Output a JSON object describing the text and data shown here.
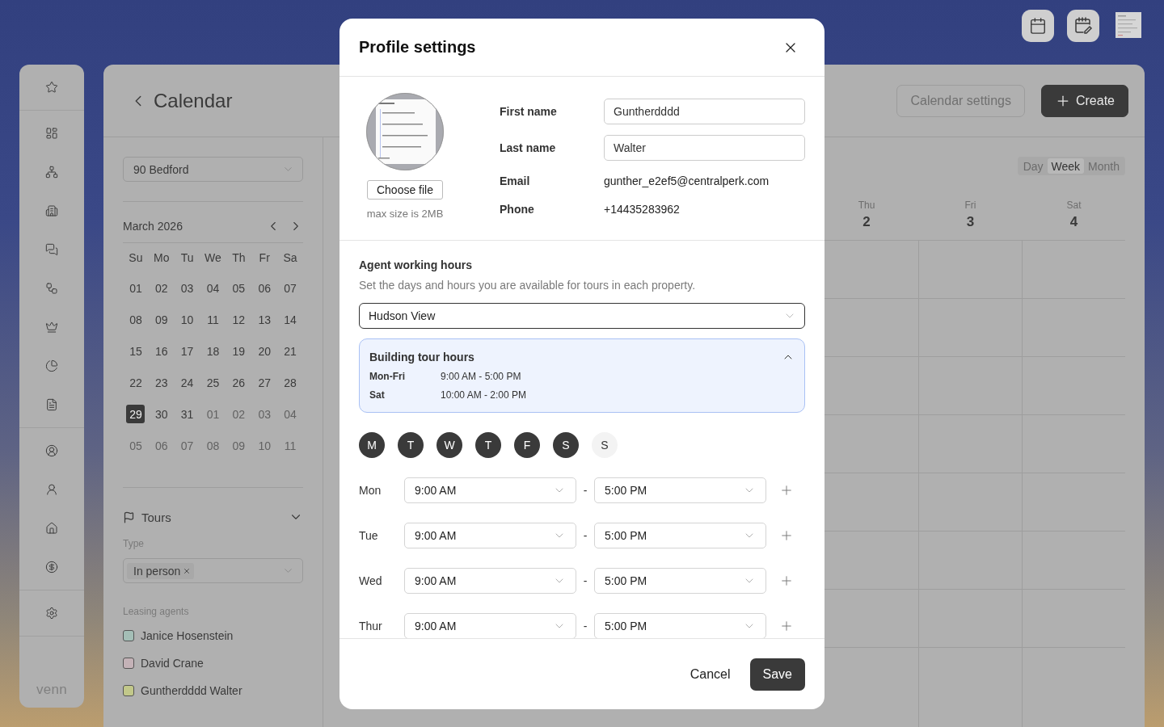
{
  "calendar_page": {
    "title": "Calendar",
    "actions": [
      {
        "label": "Calendar settings",
        "kind": "outline"
      },
      {
        "label": "Create",
        "kind": "primary"
      }
    ],
    "views": [
      {
        "label": "Day",
        "selected": false
      },
      {
        "label": "Week",
        "selected": true
      },
      {
        "label": "Month",
        "selected": false
      }
    ],
    "week_columns": [
      {
        "weekday": "Thu",
        "date": "2"
      },
      {
        "weekday": "Fri",
        "date": "3"
      },
      {
        "weekday": "Sat",
        "date": "4"
      }
    ]
  },
  "sidebar": {
    "brand": "venn"
  },
  "filters": {
    "property": "90 Bedford",
    "month": "March 2026",
    "weekdays": [
      "Su",
      "Mo",
      "Tu",
      "We",
      "Th",
      "Fr",
      "Sa"
    ],
    "days": [
      {
        "label": "01",
        "muted": false,
        "selected": false
      },
      {
        "label": "02",
        "muted": false,
        "selected": false
      },
      {
        "label": "03",
        "muted": false,
        "selected": false
      },
      {
        "label": "04",
        "muted": false,
        "selected": false
      },
      {
        "label": "05",
        "muted": false,
        "selected": false
      },
      {
        "label": "06",
        "muted": false,
        "selected": false
      },
      {
        "label": "07",
        "muted": false,
        "selected": false
      },
      {
        "label": "08",
        "muted": false,
        "selected": false
      },
      {
        "label": "09",
        "muted": false,
        "selected": false
      },
      {
        "label": "10",
        "muted": false,
        "selected": false
      },
      {
        "label": "11",
        "muted": false,
        "selected": false
      },
      {
        "label": "12",
        "muted": false,
        "selected": false
      },
      {
        "label": "13",
        "muted": false,
        "selected": false
      },
      {
        "label": "14",
        "muted": false,
        "selected": false
      },
      {
        "label": "15",
        "muted": false,
        "selected": false
      },
      {
        "label": "16",
        "muted": false,
        "selected": false
      },
      {
        "label": "17",
        "muted": false,
        "selected": false
      },
      {
        "label": "18",
        "muted": false,
        "selected": false
      },
      {
        "label": "19",
        "muted": false,
        "selected": false
      },
      {
        "label": "20",
        "muted": false,
        "selected": false
      },
      {
        "label": "21",
        "muted": false,
        "selected": false
      },
      {
        "label": "22",
        "muted": false,
        "selected": false
      },
      {
        "label": "23",
        "muted": false,
        "selected": false
      },
      {
        "label": "24",
        "muted": false,
        "selected": false
      },
      {
        "label": "25",
        "muted": false,
        "selected": false
      },
      {
        "label": "26",
        "muted": false,
        "selected": false
      },
      {
        "label": "27",
        "muted": false,
        "selected": false
      },
      {
        "label": "28",
        "muted": false,
        "selected": false
      },
      {
        "label": "29",
        "muted": false,
        "selected": true
      },
      {
        "label": "30",
        "muted": false,
        "selected": false
      },
      {
        "label": "31",
        "muted": false,
        "selected": false
      },
      {
        "label": "01",
        "muted": true,
        "selected": false
      },
      {
        "label": "02",
        "muted": true,
        "selected": false
      },
      {
        "label": "03",
        "muted": true,
        "selected": false
      },
      {
        "label": "04",
        "muted": true,
        "selected": false
      },
      {
        "label": "05",
        "muted": true,
        "selected": false
      },
      {
        "label": "06",
        "muted": true,
        "selected": false
      },
      {
        "label": "07",
        "muted": true,
        "selected": false
      },
      {
        "label": "08",
        "muted": true,
        "selected": false
      },
      {
        "label": "09",
        "muted": true,
        "selected": false
      },
      {
        "label": "10",
        "muted": true,
        "selected": false
      },
      {
        "label": "11",
        "muted": true,
        "selected": false
      }
    ],
    "tours": {
      "title": "Tours",
      "expanded": true,
      "type_label": "Type",
      "type_chips": [
        "In person"
      ],
      "agents_label": "Leasing agents",
      "agents": [
        {
          "name": "Janice Hosenstein",
          "color": "#a4beb6",
          "checked": false
        },
        {
          "name": "David Crane",
          "color": "#c4b2b7",
          "checked": false
        },
        {
          "name": "Guntherdddd Walter",
          "color": "#c2c88a",
          "checked": false
        }
      ]
    }
  },
  "modal": {
    "title": "Profile settings",
    "upload_button": "Choose file",
    "upload_hint": "max size is 2MB",
    "fields": [
      {
        "label": "First name",
        "value": "Guntherdddd",
        "kind": "input"
      },
      {
        "label": "Last name",
        "value": "Walter",
        "kind": "input"
      },
      {
        "label": "Email",
        "value": "gunther_e2ef5@centralperk.com",
        "kind": "text"
      },
      {
        "label": "Phone",
        "value": "+14435283962",
        "kind": "text"
      }
    ],
    "hours_title": "Agent working hours",
    "hours_description": "Set the days and hours you are available for tours in each property.",
    "property": "Hudson View",
    "building_hours": {
      "title": "Building tour hours",
      "expanded": true,
      "rows": [
        {
          "days": "Mon-Fri",
          "hours": "9:00 AM - 5:00 PM"
        },
        {
          "days": "Sat",
          "hours": "10:00 AM - 2:00 PM"
        }
      ]
    },
    "day_toggles": [
      {
        "label": "M",
        "selected": true
      },
      {
        "label": "T",
        "selected": true
      },
      {
        "label": "W",
        "selected": true
      },
      {
        "label": "T",
        "selected": true
      },
      {
        "label": "F",
        "selected": true
      },
      {
        "label": "S",
        "selected": true
      },
      {
        "label": "S",
        "selected": false
      }
    ],
    "schedule": [
      {
        "day": "Mon",
        "start": "9:00 AM",
        "separator": "-",
        "end": "5:00 PM"
      },
      {
        "day": "Tue",
        "start": "9:00 AM",
        "separator": "-",
        "end": "5:00 PM"
      },
      {
        "day": "Wed",
        "start": "9:00 AM",
        "separator": "-",
        "end": "5:00 PM"
      },
      {
        "day": "Thur",
        "start": "9:00 AM",
        "separator": "-",
        "end": "5:00 PM"
      }
    ],
    "cancel": "Cancel",
    "save": "Save"
  }
}
